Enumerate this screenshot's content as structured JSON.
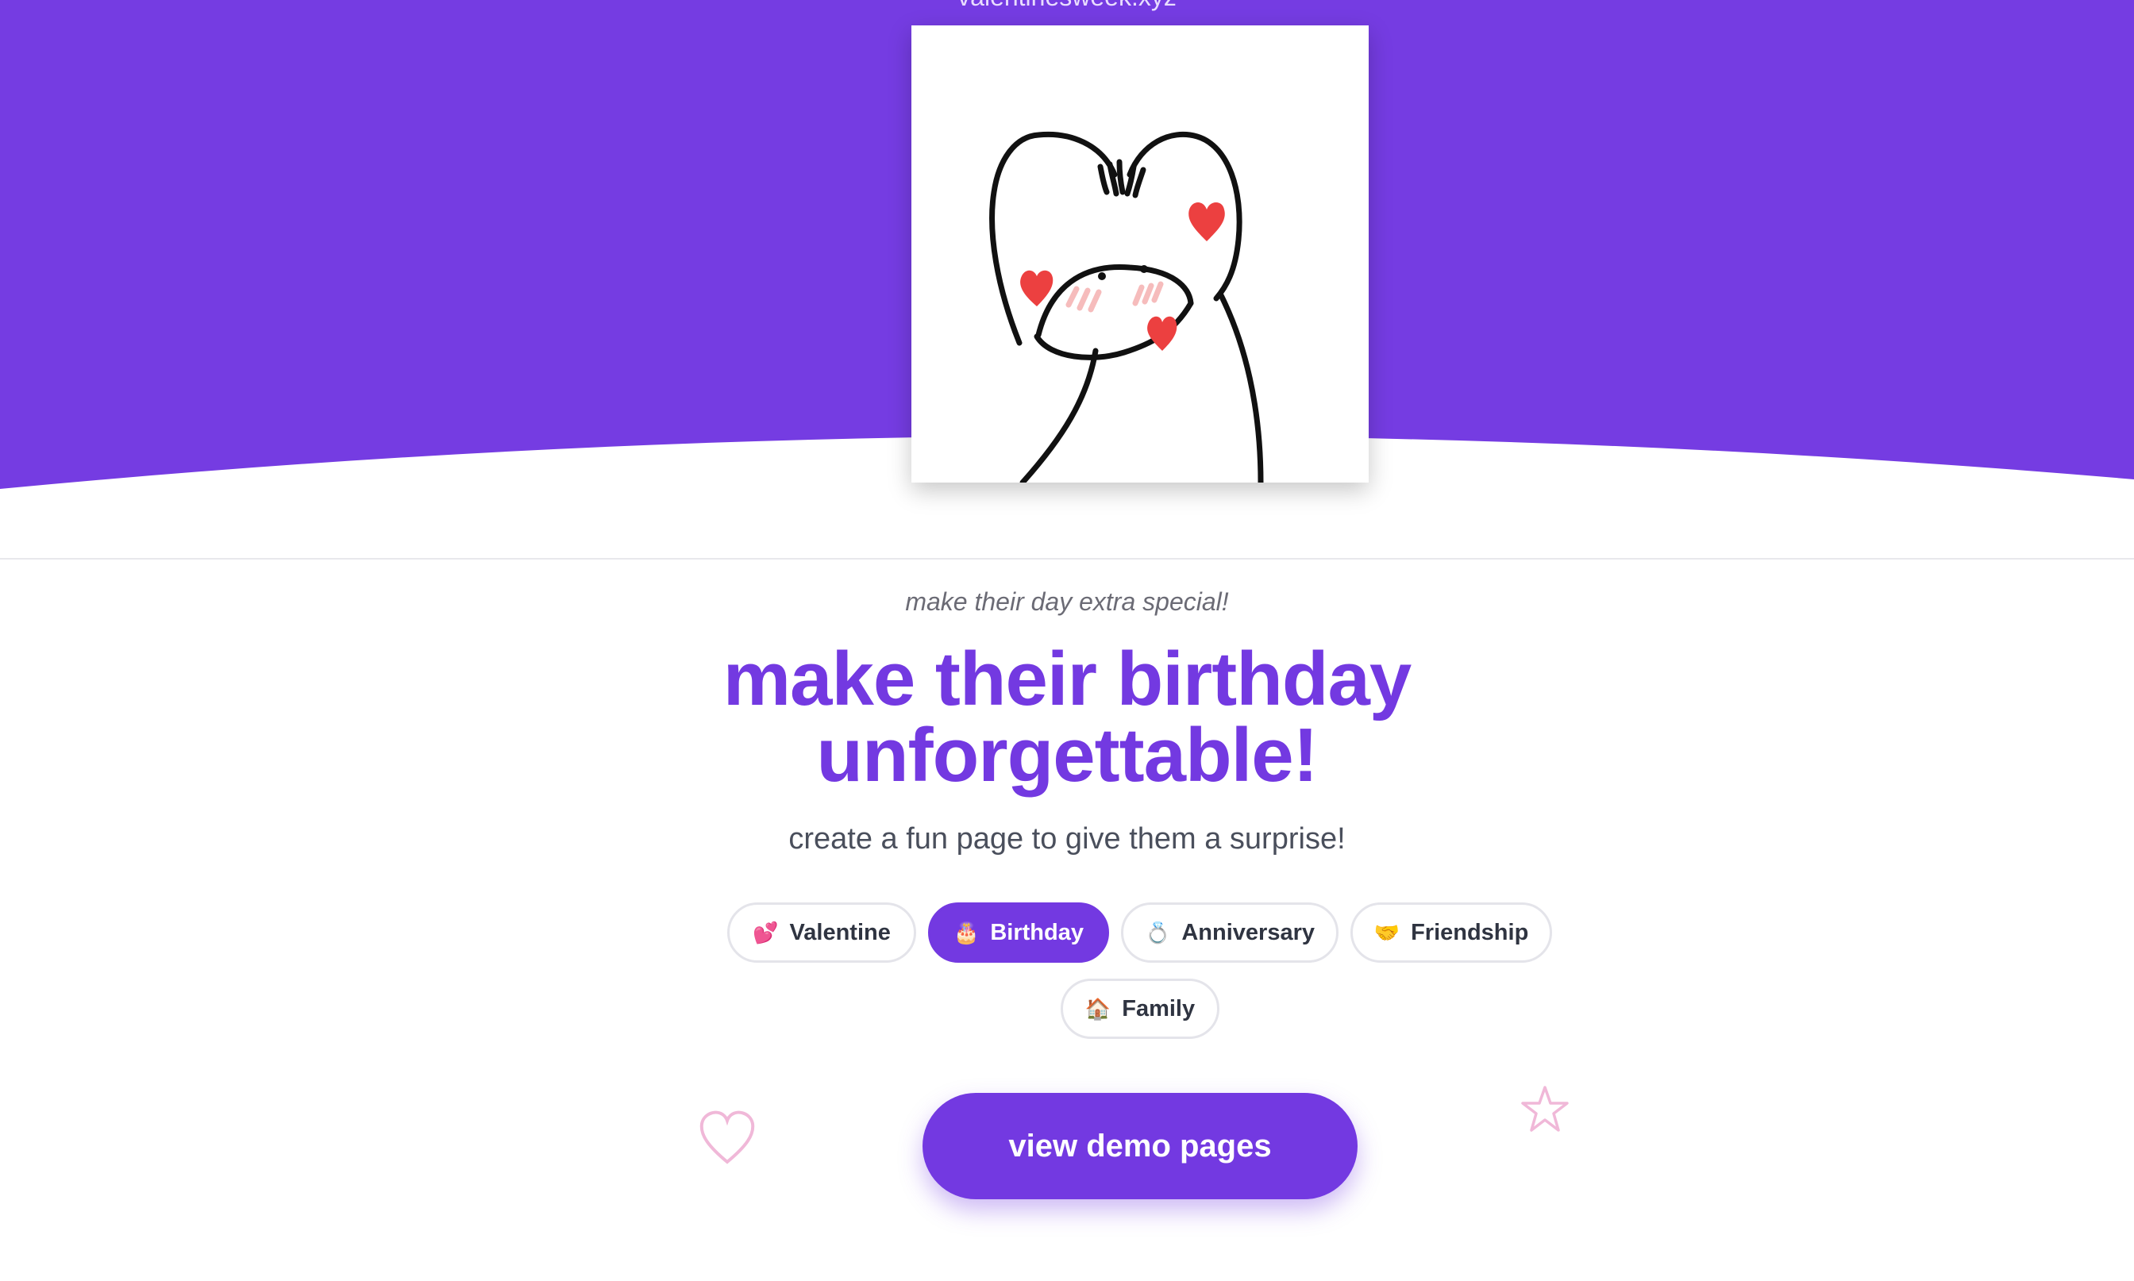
{
  "colors": {
    "brand": "#7339e1",
    "hero_background": "#753ce2",
    "decoration_pink": "#f0b8d8"
  },
  "header": {
    "site_domain": "valentinesweek.xyz"
  },
  "hero": {
    "illustration": "heart-hands-character"
  },
  "intro": {
    "tagline": "make their day extra special!",
    "headline_line1": "make their birthday",
    "headline_line2": "unforgettable!",
    "subheadline": "create a fun page to give them a surprise!"
  },
  "occasions": [
    {
      "emoji": "💕",
      "label": "Valentine",
      "selected": false
    },
    {
      "emoji": "🎂",
      "label": "Birthday",
      "selected": true
    },
    {
      "emoji": "💍",
      "label": "Anniversary",
      "selected": false
    },
    {
      "emoji": "🤝",
      "label": "Friendship",
      "selected": false
    },
    {
      "emoji": "🏠",
      "label": "Family",
      "selected": false
    }
  ],
  "cta": {
    "label": "view demo pages"
  },
  "decorations": [
    "heart-outline-icon",
    "star-outline-icon"
  ]
}
